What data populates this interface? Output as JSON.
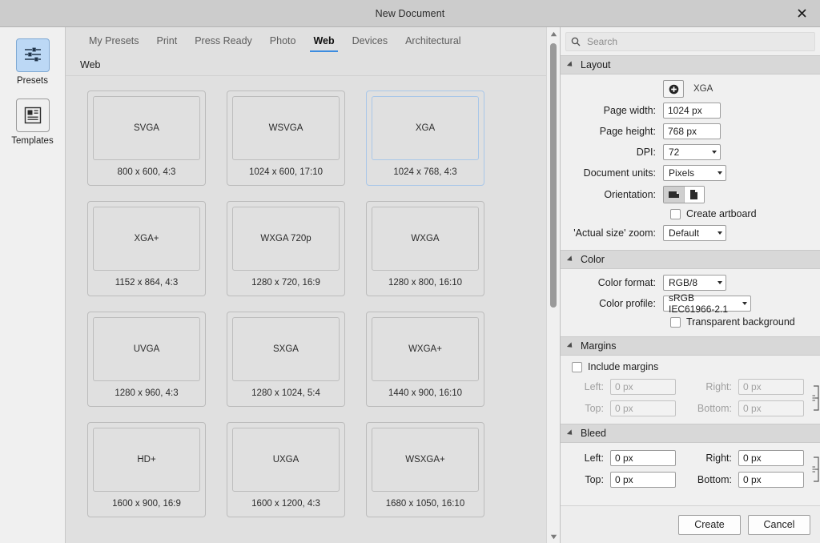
{
  "window": {
    "title": "New Document",
    "close_label": "✕"
  },
  "rail": {
    "items": [
      {
        "label": "Presets",
        "icon": "sliders-icon",
        "selected": true
      },
      {
        "label": "Templates",
        "icon": "layout-document-icon",
        "selected": false
      }
    ]
  },
  "tabs": {
    "items": [
      {
        "label": "My Presets",
        "active": false
      },
      {
        "label": "Print",
        "active": false
      },
      {
        "label": "Press Ready",
        "active": false
      },
      {
        "label": "Photo",
        "active": false
      },
      {
        "label": "Web",
        "active": true
      },
      {
        "label": "Devices",
        "active": false
      },
      {
        "label": "Architectural",
        "active": false
      }
    ],
    "accent_color": "#3c8ce0"
  },
  "category": {
    "title": "Web"
  },
  "presets": [
    {
      "name": "SVGA",
      "spec": "800 x 600, 4:3",
      "selected": false
    },
    {
      "name": "WSVGA",
      "spec": "1024 x 600, 17:10",
      "selected": false
    },
    {
      "name": "XGA",
      "spec": "1024 x 768, 4:3",
      "selected": true
    },
    {
      "name": "XGA+",
      "spec": "1152 x 864, 4:3",
      "selected": false
    },
    {
      "name": "WXGA 720p",
      "spec": "1280 x 720, 16:9",
      "selected": false
    },
    {
      "name": "WXGA",
      "spec": "1280 x 800, 16:10",
      "selected": false
    },
    {
      "name": "UVGA",
      "spec": "1280 x 960, 4:3",
      "selected": false
    },
    {
      "name": "SXGA",
      "spec": "1280 x 1024, 5:4",
      "selected": false
    },
    {
      "name": "WXGA+",
      "spec": "1440 x 900, 16:10",
      "selected": false
    },
    {
      "name": "HD+",
      "spec": "1600 x 900, 16:9",
      "selected": false
    },
    {
      "name": "UXGA",
      "spec": "1600 x 1200, 4:3",
      "selected": false
    },
    {
      "name": "WSXGA+",
      "spec": "1680 x 1050, 16:10",
      "selected": false
    }
  ],
  "search": {
    "placeholder": "Search",
    "value": "",
    "icon": "search-icon"
  },
  "layout": {
    "group_title": "Layout",
    "add_preset_icon": "add-circle-icon",
    "preset_name": "XGA",
    "page_width_label": "Page width:",
    "page_width_value": "1024 px",
    "page_height_label": "Page height:",
    "page_height_value": "768 px",
    "dpi_label": "DPI:",
    "dpi_value": "72",
    "document_units_label": "Document units:",
    "document_units_value": "Pixels",
    "orientation_label": "Orientation:",
    "orientation_landscape_icon": "landscape-page-icon",
    "orientation_portrait_icon": "portrait-page-icon",
    "orientation_selected": "landscape",
    "create_artboard_label": "Create artboard",
    "create_artboard_checked": false,
    "actual_size_zoom_label": "'Actual size' zoom:",
    "actual_size_zoom_value": "Default"
  },
  "color": {
    "group_title": "Color",
    "color_format_label": "Color format:",
    "color_format_value": "RGB/8",
    "color_profile_label": "Color profile:",
    "color_profile_value": "sRGB IEC61966-2.1",
    "transparent_background_label": "Transparent background",
    "transparent_background_checked": false
  },
  "margins": {
    "group_title": "Margins",
    "include_label": "Include margins",
    "include_checked": false,
    "enabled": false,
    "left_label": "Left:",
    "left_value": "0 px",
    "right_label": "Right:",
    "right_value": "0 px",
    "top_label": "Top:",
    "top_value": "0 px",
    "bottom_label": "Bottom:",
    "bottom_value": "0 px",
    "link_icon": "link-chain-icon"
  },
  "bleed": {
    "group_title": "Bleed",
    "enabled": true,
    "left_label": "Left:",
    "left_value": "0 px",
    "right_label": "Right:",
    "right_value": "0 px",
    "top_label": "Top:",
    "top_value": "0 px",
    "bottom_label": "Bottom:",
    "bottom_value": "0 px",
    "link_icon": "link-chain-icon"
  },
  "footer": {
    "create_label": "Create",
    "cancel_label": "Cancel"
  }
}
